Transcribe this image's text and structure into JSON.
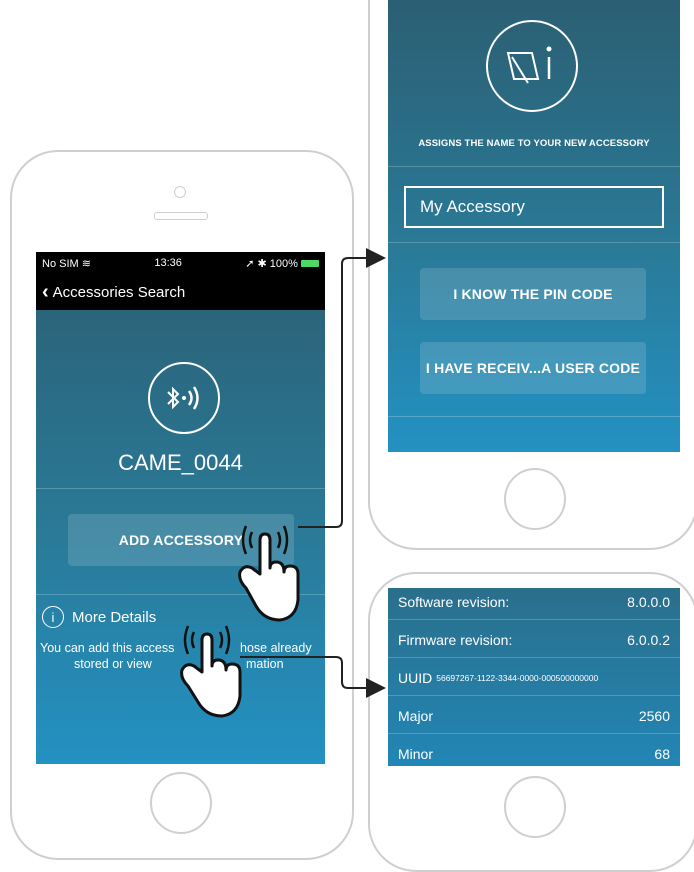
{
  "left_phone": {
    "status": {
      "carrier": "No SIM",
      "time": "13:36",
      "battery": "100%"
    },
    "nav": {
      "back_label": "Accessories Search"
    },
    "device_name": "CAME_0044",
    "add_button_label": "ADD ACCESSORY",
    "details_link": "More Details",
    "info_line1": "You can add this access",
    "info_line1_end": "hose already",
    "info_line2": "stored or view",
    "info_line2_end": "mation"
  },
  "right_phone": {
    "heading": "ASSIGNS THE NAME TO YOUR NEW ACCESSORY",
    "name_input_value": "My Accessory",
    "pin_button_label": "I KNOW THE PIN CODE",
    "user_code_button_label": "I HAVE RECEIV...A USER CODE"
  },
  "details": {
    "rows": [
      {
        "label": "Software revision:",
        "value": "8.0.0.0"
      },
      {
        "label": "Firmware revision:",
        "value": "6.0.0.2"
      },
      {
        "label": "UUID",
        "value": "56697267-1122-3344-0000-000500000000"
      },
      {
        "label": "Major",
        "value": "2560"
      },
      {
        "label": "Minor",
        "value": "68"
      }
    ]
  },
  "colors": {
    "accent": "#2a7a98",
    "frame": "#cfcfcf",
    "arrow": "#222222"
  }
}
